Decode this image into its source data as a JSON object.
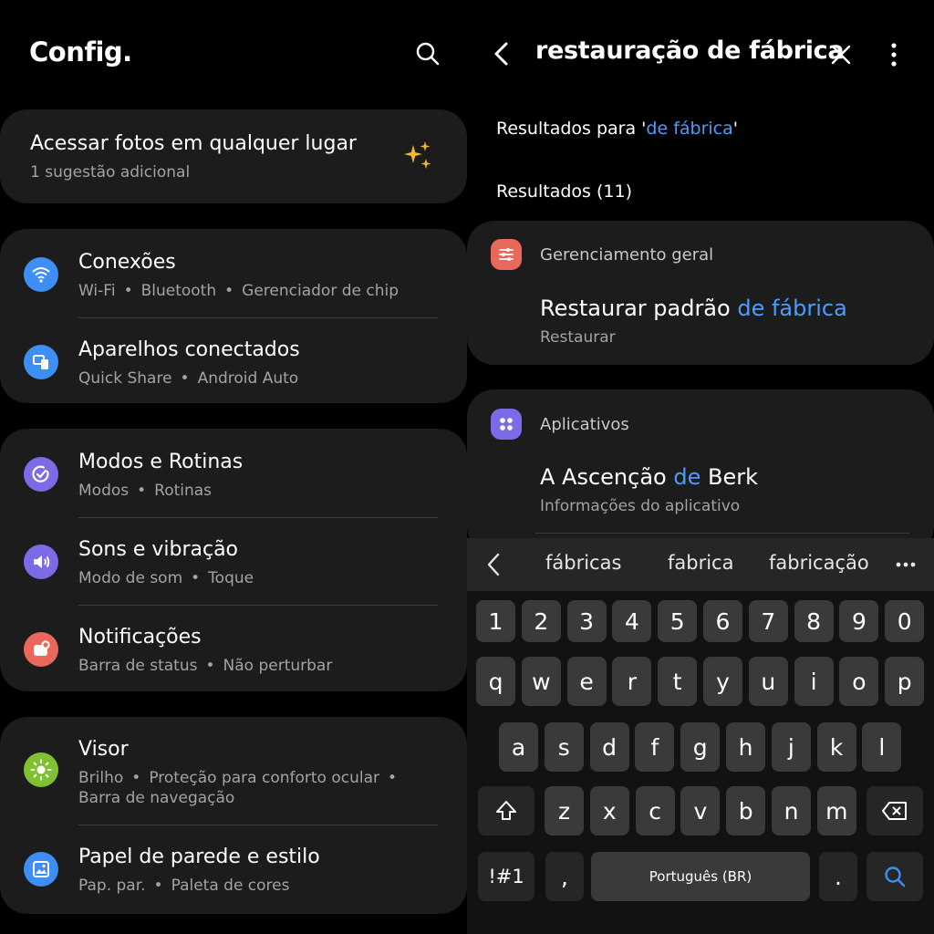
{
  "left": {
    "title": "Config.",
    "suggestion": {
      "title": "Acessar fotos em qualquer lugar",
      "subtitle": "1 sugestão adicional"
    },
    "groups": [
      [
        {
          "title": "Conexões",
          "subs": [
            "Wi-Fi",
            "Bluetooth",
            "Gerenciador de chip"
          ],
          "color": "#3d8ff5",
          "icon": "wifi-icon"
        },
        {
          "title": "Aparelhos conectados",
          "subs": [
            "Quick Share",
            "Android Auto"
          ],
          "color": "#3d8ff5",
          "icon": "devices-icon"
        }
      ],
      [
        {
          "title": "Modos e Rotinas",
          "subs": [
            "Modos",
            "Rotinas"
          ],
          "color": "#7b6be6",
          "icon": "check-circle-icon"
        },
        {
          "title": "Sons e vibração",
          "subs": [
            "Modo de som",
            "Toque"
          ],
          "color": "#7b6be6",
          "icon": "speaker-icon"
        },
        {
          "title": "Notificações",
          "subs": [
            "Barra de status",
            "Não perturbar"
          ],
          "color": "#e8685c",
          "icon": "bell-icon"
        }
      ],
      [
        {
          "title": "Visor",
          "subs": [
            "Brilho",
            "Proteção para conforto ocular"
          ],
          "subs2": "Barra de navegação",
          "color": "#7ec232",
          "icon": "sun-icon"
        },
        {
          "title": "Papel de parede e estilo",
          "subs": [
            "Pap. par.",
            "Paleta de cores"
          ],
          "color": "#3d8ff5",
          "icon": "image-icon"
        }
      ]
    ]
  },
  "right": {
    "query": "restauração de fábrica",
    "results_for_prefix": "Resultados para '",
    "results_for_term": "de fábrica",
    "results_for_suffix": "'",
    "results_count": "Resultados (11)",
    "categories": [
      {
        "label": "Gerenciamento geral",
        "color": "#e8685c",
        "icon": "sliders-icon",
        "item_pre": "Restaurar padrão ",
        "item_hl": "de fábrica",
        "item_post": "",
        "item_sub": "Restaurar"
      },
      {
        "label": "Aplicativos",
        "color": "#7b6be6",
        "icon": "apps-icon",
        "item_pre": "A Ascenção ",
        "item_hl": "de",
        "item_post": " Berk",
        "item_sub": "Informações do aplicativo"
      }
    ],
    "suggestions": [
      "fábricas",
      "fabrica",
      "fabricação"
    ],
    "keyboard": {
      "row_numbers": [
        "1",
        "2",
        "3",
        "4",
        "5",
        "6",
        "7",
        "8",
        "9",
        "0"
      ],
      "row1": [
        "q",
        "w",
        "e",
        "r",
        "t",
        "y",
        "u",
        "i",
        "o",
        "p"
      ],
      "row2": [
        "a",
        "s",
        "d",
        "f",
        "g",
        "h",
        "j",
        "k",
        "l"
      ],
      "row3": [
        "z",
        "x",
        "c",
        "v",
        "b",
        "n",
        "m"
      ],
      "symbols": "!#1",
      "comma": ",",
      "space": "Português (BR)",
      "period": "."
    }
  },
  "colors": {
    "accent": "#4e9bff",
    "card": "#1c1c1c",
    "background": "#000000"
  }
}
